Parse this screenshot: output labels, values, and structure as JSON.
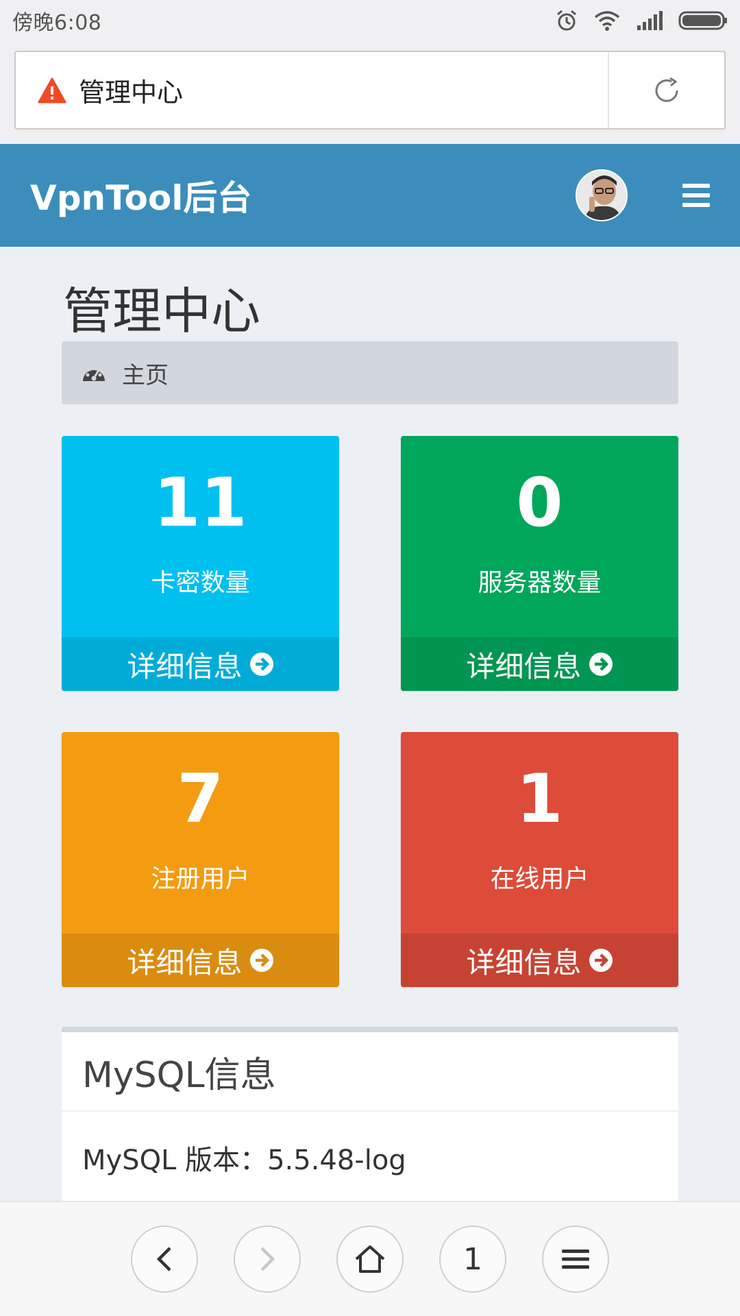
{
  "status_bar": {
    "time": "傍晚6:08",
    "icons": [
      "alarm-icon",
      "wifi-icon",
      "signal-icon",
      "battery-icon"
    ]
  },
  "browser": {
    "page_title": "管理中心",
    "warning_icon": "warning-icon",
    "reload_icon": "reload-icon"
  },
  "header": {
    "brand": "VpnTool后台",
    "accent_color": "#3c8dbc"
  },
  "content": {
    "title": "管理中心",
    "breadcrumb": "主页"
  },
  "boxes": [
    {
      "value": "11",
      "label": "卡密数量",
      "link": "详细信息",
      "color": "#00c0ef"
    },
    {
      "value": "0",
      "label": "服务器数量",
      "link": "详细信息",
      "color": "#00a65a"
    },
    {
      "value": "7",
      "label": "注册用户",
      "link": "详细信息",
      "color": "#f39c12"
    },
    {
      "value": "1",
      "label": "在线用户",
      "link": "详细信息",
      "color": "#dd4b39"
    }
  ],
  "mysql_panel": {
    "title": "MySQL信息",
    "version_label": "MySQL 版本：",
    "version_value": "5.5.48-log"
  },
  "bottom_nav": {
    "tab_count": "1"
  }
}
